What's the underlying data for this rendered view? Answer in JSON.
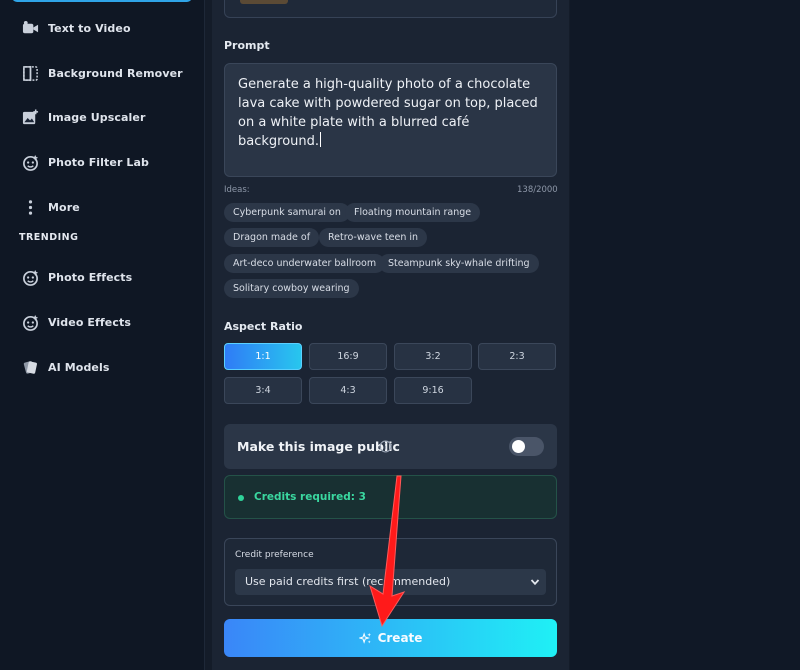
{
  "sidebar": {
    "items": [
      {
        "label": "Text to Video",
        "icon": "video-camera-icon"
      },
      {
        "label": "Background Remover",
        "icon": "split-frame-icon"
      },
      {
        "label": "Image Upscaler",
        "icon": "image-plus-icon"
      },
      {
        "label": "Photo Filter Lab",
        "icon": "filter-lens-icon"
      },
      {
        "label": "More",
        "icon": "more-vertical-icon"
      }
    ],
    "trending_label": "TRENDING",
    "trending_items": [
      {
        "label": "Photo Effects",
        "icon": "sparkle-lens-icon"
      },
      {
        "label": "Video Effects",
        "icon": "sparkle-lens-icon"
      },
      {
        "label": "AI Models",
        "icon": "cards-icon"
      }
    ]
  },
  "form": {
    "prompt_label": "Prompt",
    "prompt_text": "Generate a high-quality photo of a chocolate lava cake with powdered sugar on top, placed on a white plate with a blurred café background.",
    "ideas_label": "Ideas:",
    "char_count": "138/2000",
    "ideas": [
      "Cyberpunk samurai on",
      "Floating mountain range",
      "Dragon made of",
      "Retro-wave teen in",
      "Art-deco underwater ballroom",
      "Steampunk sky-whale drifting",
      "Solitary cowboy wearing"
    ],
    "aspect_label": "Aspect Ratio",
    "aspect_ratios": [
      "1:1",
      "16:9",
      "3:2",
      "2:3",
      "3:4",
      "4:3",
      "9:16"
    ],
    "aspect_selected": "1:1",
    "public_label": "Make this image public",
    "public_enabled": false,
    "credits_text": "Credits required: 3",
    "credit_pref_label": "Credit preference",
    "credit_pref_value": "Use paid credits first (recommended)",
    "create_label": "Create"
  },
  "colors": {
    "accent_start": "#3a86f8",
    "accent_end": "#1ff0f5",
    "credits_green": "#3ad8a0",
    "annotation_arrow": "#ff1a1a"
  }
}
